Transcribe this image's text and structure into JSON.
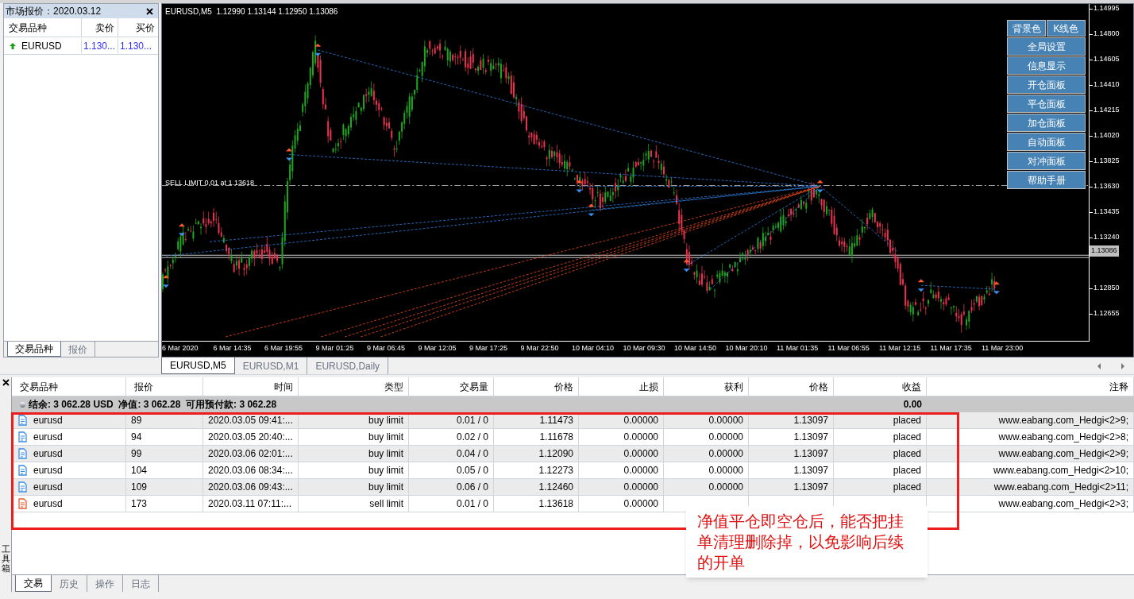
{
  "market_watch": {
    "title": "市场报价：2020.03.12",
    "columns": [
      "交易品种",
      "卖价",
      "买价"
    ],
    "rows": [
      {
        "symbol": "EURUSD",
        "bid": "1.130...",
        "ask": "1.130...",
        "rising": true
      }
    ],
    "tabs": [
      {
        "label": "交易品种",
        "selected": true
      },
      {
        "label": "报价",
        "selected": false
      }
    ]
  },
  "chart": {
    "header": "EURUSD,M5  1.12990 1.13144 1.12950 1.13086",
    "order_label": "SELL LIMIT 0.01 at 1.13618",
    "price_axis": [
      "1.14995",
      "1.14800",
      "1.14605",
      "1.14410",
      "1.14215",
      "1.14020",
      "1.13825",
      "1.13630",
      "1.13435",
      "1.13240"
    ],
    "current_price": "1.13086",
    "price_axis_lower": [
      "1.12850",
      "1.12655"
    ],
    "time_axis": [
      "6 Mar 2020",
      "6 Mar 14:35",
      "6 Mar 19:55",
      "9 Mar 01:25",
      "9 Mar 06:45",
      "9 Mar 12:05",
      "9 Mar 17:25",
      "9 Mar 22:50",
      "10 Mar 04:10",
      "10 Mar 09:30",
      "10 Mar 14:50",
      "10 Mar 20:10",
      "11 Mar 01:35",
      "11 Mar 06:55",
      "11 Mar 12:15",
      "11 Mar 17:35",
      "11 Mar 23:00"
    ],
    "panel_top": [
      "背景色",
      "K线色"
    ],
    "panel_buttons": [
      "全局设置",
      "信息显示",
      "开仓面板",
      "平仓面板",
      "加仓面板",
      "自动面板",
      "对冲面板",
      "帮助手册"
    ]
  },
  "chart_tabs": [
    {
      "label": "EURUSD,M5",
      "selected": true
    },
    {
      "label": "EURUSD,M1",
      "selected": false
    },
    {
      "label": "EURUSD,Daily",
      "selected": false
    }
  ],
  "terminal": {
    "side_label": "工具箱",
    "columns": [
      "交易品种",
      "报价",
      "时间",
      "类型",
      "交易量",
      "价格",
      "止损",
      "获利",
      "价格",
      "收益",
      "注释"
    ],
    "summary": {
      "text": "结余: 3 062.28 USD  净值: 3 062.28  可用预付款: 3 062.28",
      "profit": "0.00"
    },
    "orders": [
      {
        "kind": "buy",
        "symbol": "eurusd",
        "ticket": "89",
        "time": "2020.03.05 09:41:...",
        "type": "buy limit",
        "volume": "0.01 / 0",
        "price": "1.11473",
        "sl": "0.00000",
        "tp": "0.00000",
        "current": "1.13097",
        "profit": "placed",
        "comment": "www.eabang.com_Hedgi<2>9;"
      },
      {
        "kind": "buy",
        "symbol": "eurusd",
        "ticket": "94",
        "time": "2020.03.05 20:40:...",
        "type": "buy limit",
        "volume": "0.02 / 0",
        "price": "1.11678",
        "sl": "0.00000",
        "tp": "0.00000",
        "current": "1.13097",
        "profit": "placed",
        "comment": "www.eabang.com_Hedgi<2>8;"
      },
      {
        "kind": "buy",
        "symbol": "eurusd",
        "ticket": "99",
        "time": "2020.03.06 02:01:...",
        "type": "buy limit",
        "volume": "0.04 / 0",
        "price": "1.12090",
        "sl": "0.00000",
        "tp": "0.00000",
        "current": "1.13097",
        "profit": "placed",
        "comment": "www.eabang.com_Hedgi<2>9;"
      },
      {
        "kind": "buy",
        "symbol": "eurusd",
        "ticket": "104",
        "time": "2020.03.06 08:34:...",
        "type": "buy limit",
        "volume": "0.05 / 0",
        "price": "1.12273",
        "sl": "0.00000",
        "tp": "0.00000",
        "current": "1.13097",
        "profit": "placed",
        "comment": "www.eabang.com_Hedgi<2>10;"
      },
      {
        "kind": "buy",
        "symbol": "eurusd",
        "ticket": "109",
        "time": "2020.03.06 09:43:...",
        "type": "buy limit",
        "volume": "0.06 / 0",
        "price": "1.12460",
        "sl": "0.00000",
        "tp": "0.00000",
        "current": "1.13097",
        "profit": "placed",
        "comment": "www.eabang.com_Hedgi<2>11;"
      },
      {
        "kind": "sell",
        "symbol": "eurusd",
        "ticket": "173",
        "time": "2020.03.11 07:11:...",
        "type": "sell limit",
        "volume": "0.01 / 0",
        "price": "1.13618",
        "sl": "0.00000",
        "comment": "www.eabang.com_Hedgi<2>3;"
      }
    ],
    "tabs": [
      {
        "label": "交易",
        "selected": true
      },
      {
        "label": "历史",
        "selected": false
      },
      {
        "label": "操作",
        "selected": false
      },
      {
        "label": "日志",
        "selected": false
      }
    ]
  },
  "annotation": {
    "text": "净值平仓即空仓后，能否把挂单清理删除掉，以免影响后续的开单"
  }
}
